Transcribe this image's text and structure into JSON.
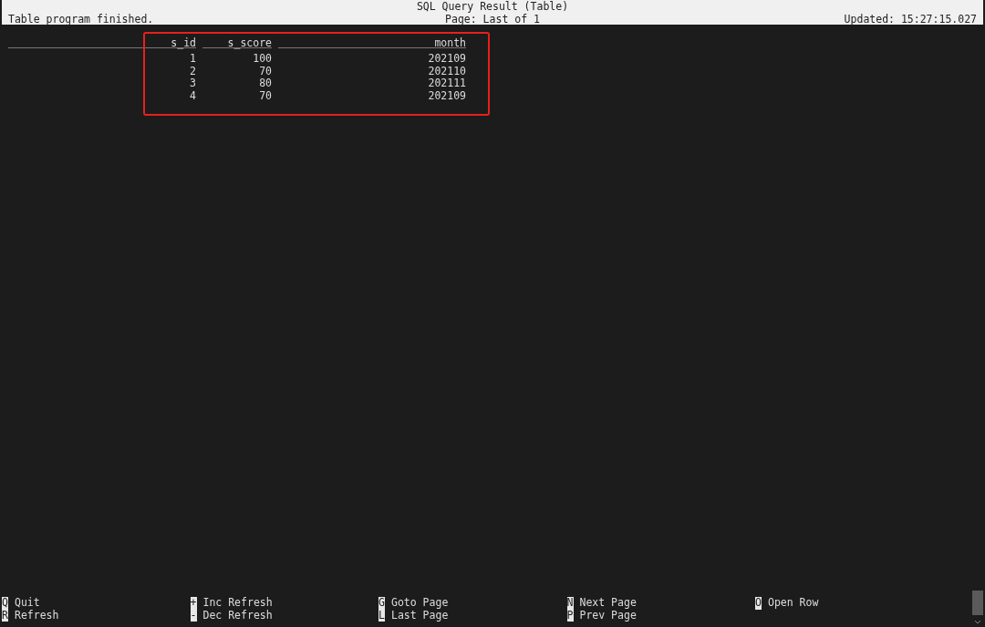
{
  "header": {
    "title": "SQL Query Result (Table)",
    "status": "Table program finished.",
    "page": "Page: Last of 1",
    "updated": "Updated: 15:27:15.027"
  },
  "table": {
    "columns": [
      "s_id",
      "s_score",
      "month"
    ],
    "rows": [
      [
        "1",
        "100",
        "202109"
      ],
      [
        "2",
        "70",
        "202110"
      ],
      [
        "3",
        "80",
        "202111"
      ],
      [
        "4",
        "70",
        "202109"
      ]
    ]
  },
  "footer": [
    [
      {
        "key": "Q",
        "label": "Quit"
      },
      {
        "key": "R",
        "label": "Refresh"
      }
    ],
    [
      {
        "key": "+",
        "label": "Inc Refresh"
      },
      {
        "key": "-",
        "label": "Dec Refresh"
      }
    ],
    [
      {
        "key": "G",
        "label": "Goto Page"
      },
      {
        "key": "L",
        "label": "Last Page"
      }
    ],
    [
      {
        "key": "N",
        "label": "Next Page"
      },
      {
        "key": "P",
        "label": "Prev Page"
      }
    ],
    [
      {
        "key": "O",
        "label": "Open Row"
      }
    ]
  ]
}
